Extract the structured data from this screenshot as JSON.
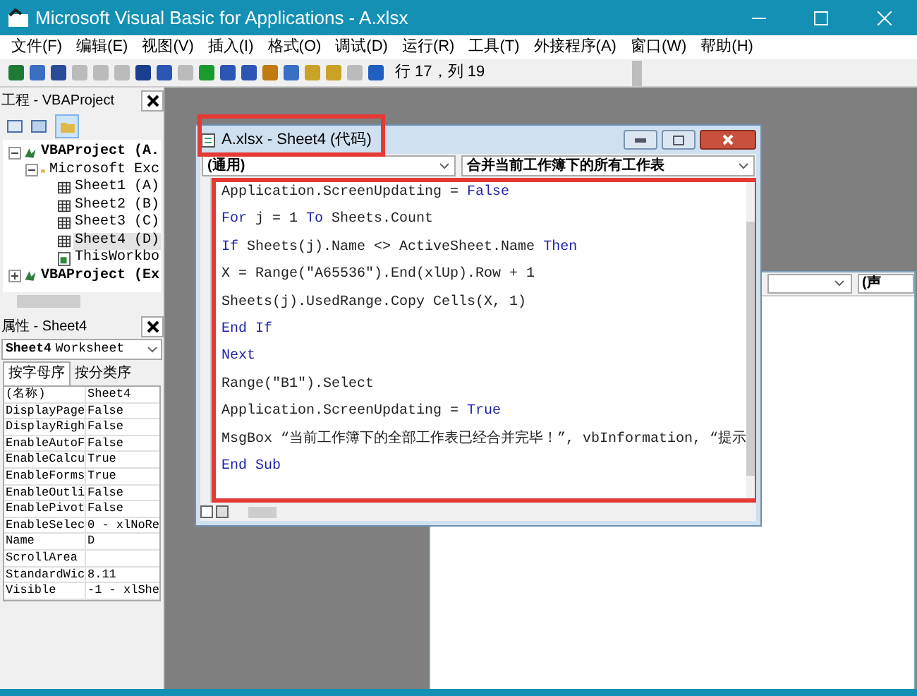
{
  "window": {
    "title": "Microsoft Visual Basic for Applications - A.xlsx"
  },
  "menu": [
    "文件(F)",
    "编辑(E)",
    "视图(V)",
    "插入(I)",
    "格式(O)",
    "调试(D)",
    "运行(R)",
    "工具(T)",
    "外接程序(A)",
    "窗口(W)",
    "帮助(H)"
  ],
  "toolbar": {
    "position": "行 17，列 19"
  },
  "project_panel": {
    "title": "工程 - VBAProject",
    "tree": [
      {
        "label": "VBAProject (A.",
        "kind": "project",
        "expanded": true,
        "selected": false,
        "children": [
          {
            "label": "Microsoft Exc",
            "kind": "folder",
            "expanded": true,
            "selected": false,
            "children": [
              {
                "label": "Sheet1 (A)",
                "kind": "sheet",
                "selected": false
              },
              {
                "label": "Sheet2 (B)",
                "kind": "sheet",
                "selected": false
              },
              {
                "label": "Sheet3 (C)",
                "kind": "sheet",
                "selected": false
              },
              {
                "label": "Sheet4 (D)",
                "kind": "sheet",
                "selected": true
              },
              {
                "label": "ThisWorkbo",
                "kind": "workbook",
                "selected": false
              }
            ]
          }
        ]
      },
      {
        "label": "VBAProject (Ex",
        "kind": "project",
        "expanded": false,
        "selected": false
      }
    ]
  },
  "properties_panel": {
    "title": "属性 - Sheet4",
    "object_name": "Sheet4",
    "object_type": "Worksheet",
    "tabs": [
      {
        "label": "按字母序",
        "selected": true
      },
      {
        "label": "按分类序",
        "selected": false
      }
    ],
    "rows": [
      {
        "name": "(名称)",
        "value": "Sheet4"
      },
      {
        "name": "DisplayPage",
        "value": "False"
      },
      {
        "name": "DisplayRigh",
        "value": "False"
      },
      {
        "name": "EnableAutoF",
        "value": "False"
      },
      {
        "name": "EnableCalcu",
        "value": "True"
      },
      {
        "name": "EnableForms",
        "value": "True"
      },
      {
        "name": "EnableOutli",
        "value": "False"
      },
      {
        "name": "EnablePivot",
        "value": "False"
      },
      {
        "name": "EnableSelec",
        "value": "0 - xlNoRe"
      },
      {
        "name": "Name",
        "value": "D"
      },
      {
        "name": "ScrollArea",
        "value": ""
      },
      {
        "name": "StandardWic",
        "value": "8.11"
      },
      {
        "name": "Visible",
        "value": "-1 - xlShe"
      }
    ]
  },
  "back_window": {
    "procedure_combo": "(声"
  },
  "code_window": {
    "title": "A.xlsx - Sheet4 (代码)",
    "object_combo": "(通用)",
    "procedure_combo": "合并当前工作簿下的所有工作表",
    "lines": [
      [
        {
          "text": "Application.ScreenUpdating = ",
          "kind": "code"
        },
        {
          "text": "False",
          "kind": "keyword"
        }
      ],
      [
        {
          "text": "For",
          "kind": "keyword"
        },
        {
          "text": " j = 1 ",
          "kind": "code"
        },
        {
          "text": "To",
          "kind": "keyword"
        },
        {
          "text": " Sheets.Count",
          "kind": "code"
        }
      ],
      [
        {
          "text": "If",
          "kind": "keyword"
        },
        {
          "text": " Sheets(j).Name <> ActiveSheet.Name ",
          "kind": "code"
        },
        {
          "text": "Then",
          "kind": "keyword"
        }
      ],
      [
        {
          "text": "X = Range(\"A65536\").End(xlUp).Row + 1",
          "kind": "code"
        }
      ],
      [
        {
          "text": "Sheets(j).UsedRange.Copy Cells(X, 1)",
          "kind": "code"
        }
      ],
      [
        {
          "text": "End If",
          "kind": "keyword"
        }
      ],
      [
        {
          "text": "Next",
          "kind": "keyword"
        }
      ],
      [
        {
          "text": "Range(\"B1\").Select",
          "kind": "code"
        }
      ],
      [
        {
          "text": "Application.ScreenUpdating = ",
          "kind": "code"
        },
        {
          "text": "True",
          "kind": "keyword"
        }
      ],
      [
        {
          "text": "MsgBox “当前工作簿下的全部工作表已经合并完毕！”, vbInformation, “提示",
          "kind": "code"
        }
      ],
      [
        {
          "text": "End Sub",
          "kind": "keyword"
        }
      ]
    ]
  }
}
